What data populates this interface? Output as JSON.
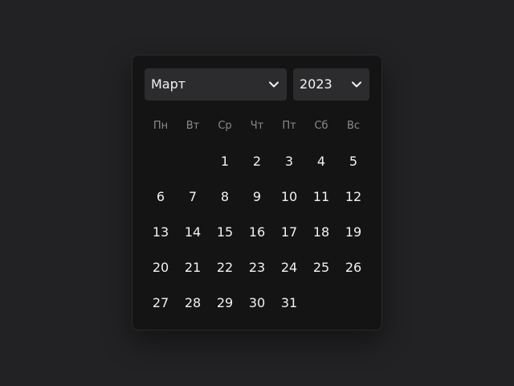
{
  "month_select": {
    "value": "Март",
    "icon": "chevron-down-icon"
  },
  "year_select": {
    "value": "2023",
    "icon": "chevron-down-icon"
  },
  "weekdays": [
    "Пн",
    "Вт",
    "Ср",
    "Чт",
    "Пт",
    "Сб",
    "Вс"
  ],
  "days": [
    [
      "",
      "",
      "1",
      "2",
      "3",
      "4",
      "5"
    ],
    [
      "6",
      "7",
      "8",
      "9",
      "10",
      "11",
      "12"
    ],
    [
      "13",
      "14",
      "15",
      "16",
      "17",
      "18",
      "19"
    ],
    [
      "20",
      "21",
      "22",
      "23",
      "24",
      "25",
      "26"
    ],
    [
      "27",
      "28",
      "29",
      "30",
      "31",
      "",
      ""
    ]
  ],
  "colors": {
    "background": "#222224",
    "panel": "#141414",
    "select": "#2c2c2e",
    "text": "#f2f2f2",
    "muted": "#8b8b8e"
  }
}
